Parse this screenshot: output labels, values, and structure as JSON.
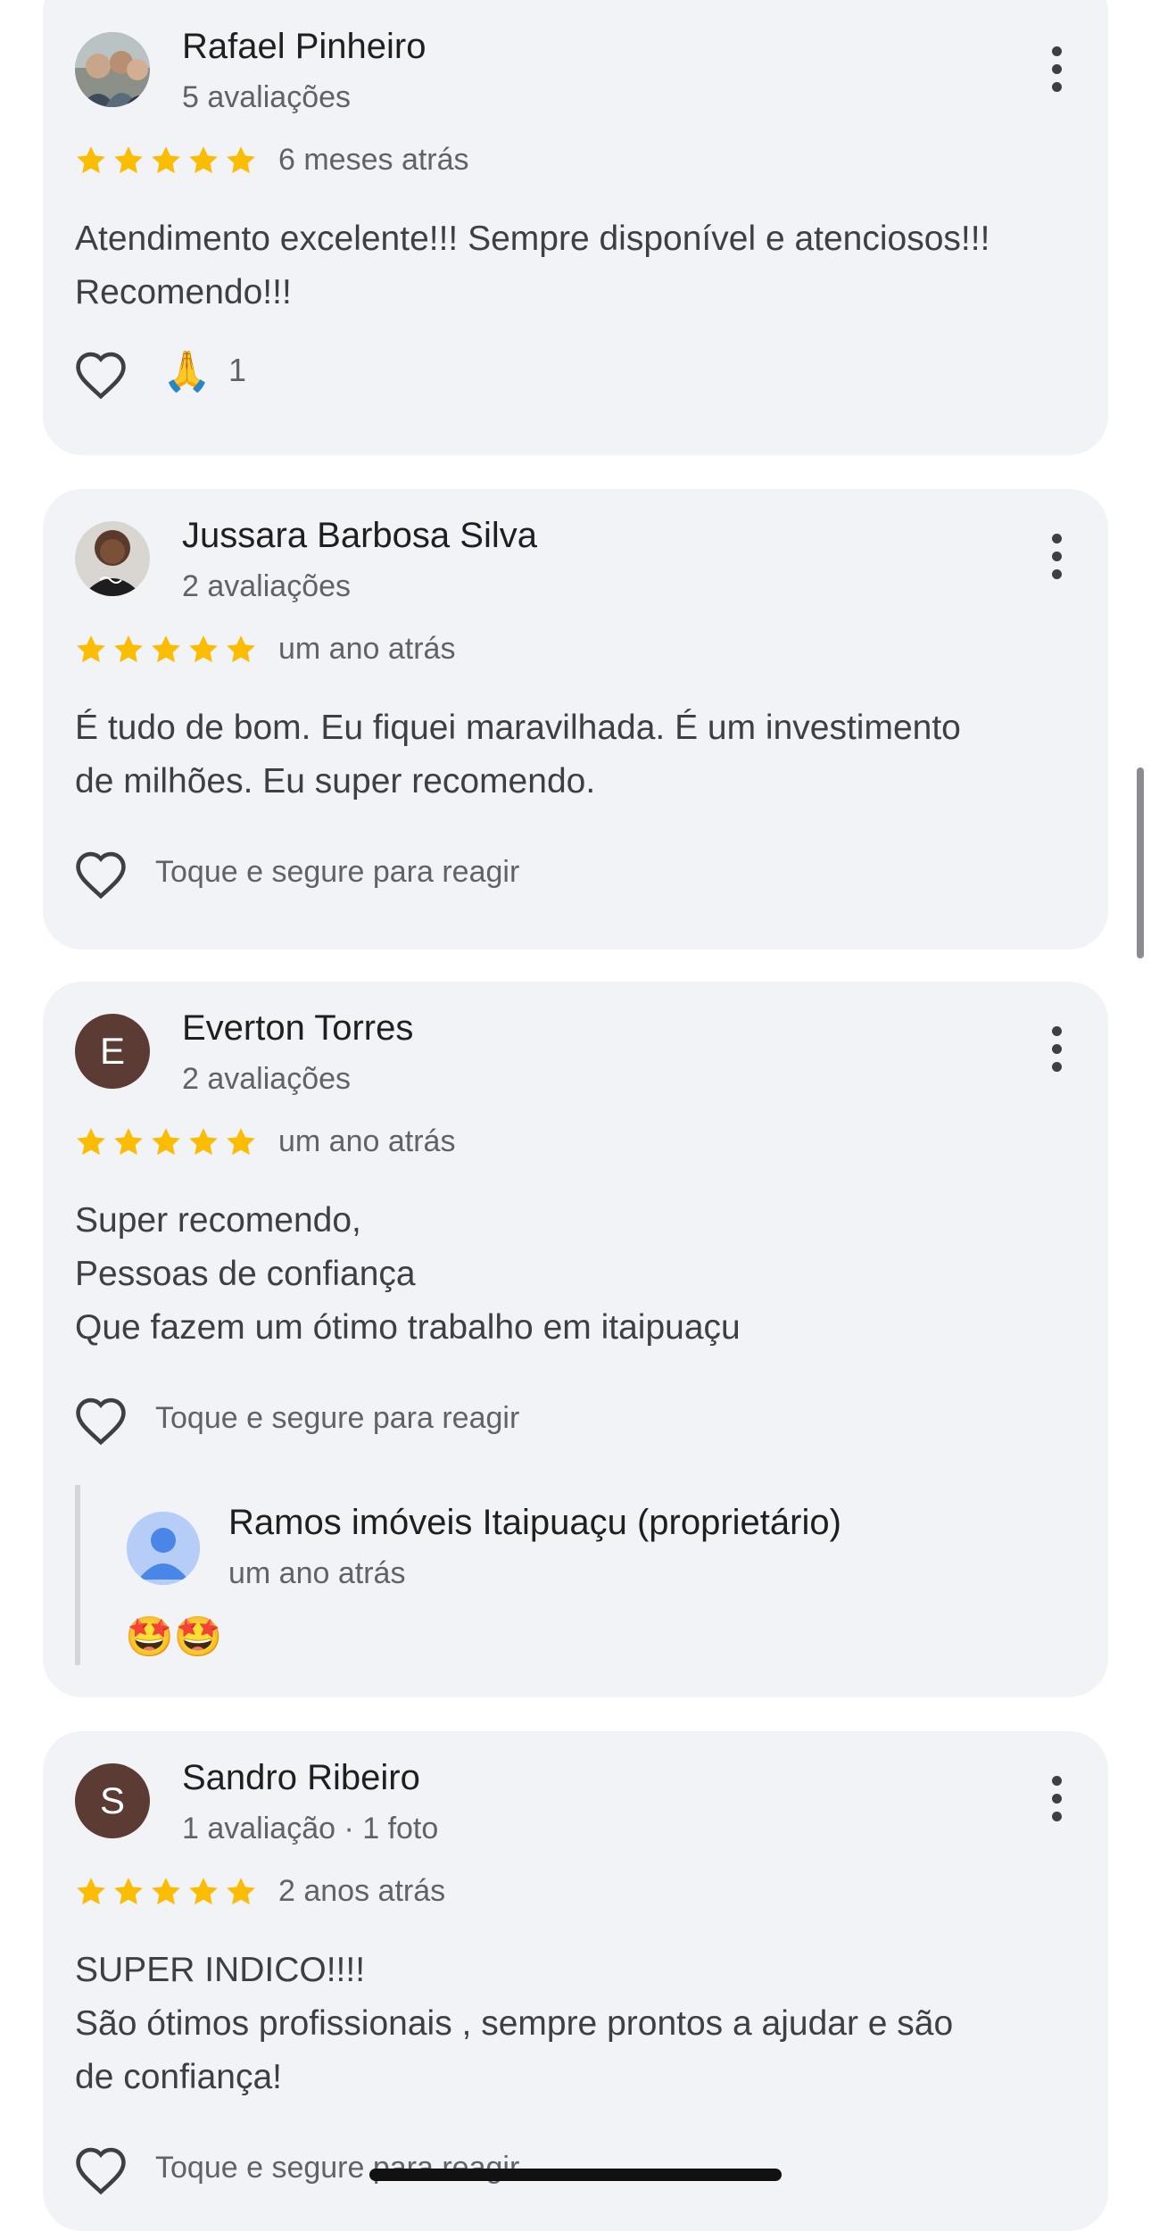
{
  "reviews": [
    {
      "name": "Rafael Pinheiro",
      "meta": "5 avaliações",
      "rating": 5,
      "time": "6 meses atrás",
      "text": "Atendimento excelente!!! Sempre disponível e atenciosos!!!\nRecomendo!!!",
      "reaction_emoji": "🙏",
      "reaction_count": "1"
    },
    {
      "name": "Jussara Barbosa Silva",
      "meta": "2 avaliações",
      "rating": 5,
      "time": "um ano atrás",
      "text": "É tudo de bom. Eu fiquei maravilhada. É um investimento\nde milhões. Eu super recomendo.",
      "react_hint": "Toque e segure para reagir"
    },
    {
      "name": "Everton Torres",
      "avatar_letter": "E",
      "meta": "2 avaliações",
      "rating": 5,
      "time": "um ano atrás",
      "text": "Super recomendo,\nPessoas de confiança\nQue fazem um ótimo trabalho em itaipuaçu",
      "react_hint": "Toque e segure para reagir",
      "owner_reply": {
        "name": "Ramos imóveis Itaipuaçu (proprietário)",
        "time": "um ano atrás",
        "text": "🤩🤩"
      }
    },
    {
      "name": "Sandro Ribeiro",
      "avatar_letter": "S",
      "meta": "1 avaliação · 1 foto",
      "rating": 5,
      "time": "2 anos atrás",
      "text": "SUPER INDICO!!!!\nSão ótimos profissionais , sempre prontos a ajudar e são\nde confiança!",
      "react_hint": "Toque e segure para reagir"
    }
  ],
  "colors": {
    "card_bg": "#f2f3f6",
    "star": "#fbbc04",
    "letter_avatar": "#5b3b33",
    "secondary_text": "#5f6368"
  },
  "icons": [
    "heart-outline-icon",
    "star-icon",
    "more-vert-icon",
    "person-icon"
  ]
}
